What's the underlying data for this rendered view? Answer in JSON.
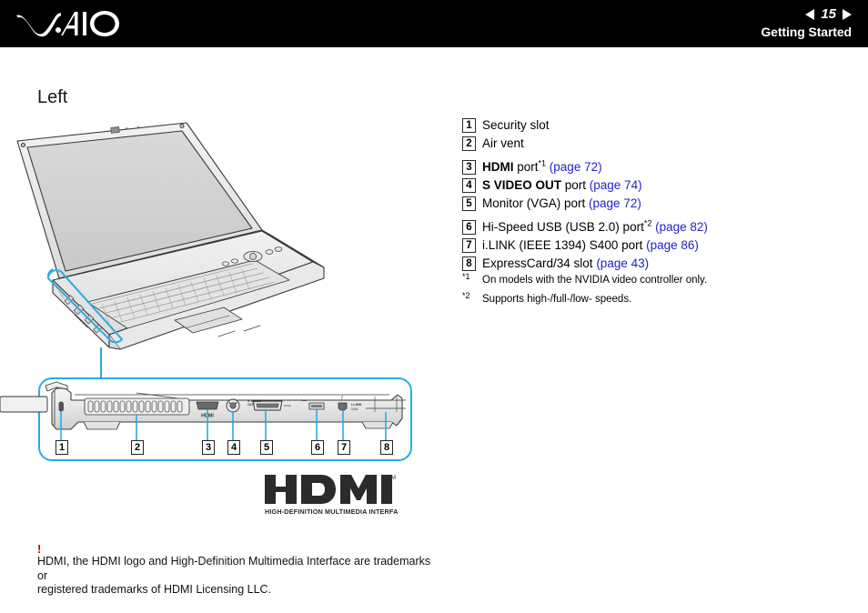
{
  "header": {
    "logo_name": "vaio-logo",
    "page_number": "15",
    "prev_icon": "triangle-left-icon",
    "next_icon": "triangle-right-icon",
    "section_title": "Getting Started",
    "background": "#000000",
    "text_color": "#ffffff"
  },
  "page": {
    "heading": "Left"
  },
  "legend": {
    "items": [
      {
        "num": "1",
        "pre": "Security slot",
        "bold": "",
        "post": "",
        "sup": "",
        "link": ""
      },
      {
        "num": "2",
        "pre": "Air vent",
        "bold": "",
        "post": "",
        "sup": "",
        "link": ""
      },
      {
        "num": "3",
        "pre": "",
        "bold": "HDMI",
        "post": " port",
        "sup": "*1",
        "link": "(page 72)"
      },
      {
        "num": "4",
        "pre": "",
        "bold": "S VIDEO OUT",
        "post": " port ",
        "sup": "",
        "link": "(page 74)"
      },
      {
        "num": "5",
        "pre": "Monitor (VGA) port ",
        "bold": "",
        "post": "",
        "sup": "",
        "link": "(page 72)"
      },
      {
        "num": "6",
        "pre": "Hi-Speed USB (USB 2.0) port",
        "bold": "",
        "post": "",
        "sup": "*2",
        "link": "(page 82)"
      },
      {
        "num": "7",
        "pre": "i.LINK (IEEE 1394) S400 port ",
        "bold": "",
        "post": "",
        "sup": "",
        "link": "(page 86)"
      },
      {
        "num": "8",
        "pre": "ExpressCard/34 slot ",
        "bold": "",
        "post": "",
        "sup": "",
        "link": "(page 43)"
      }
    ],
    "link_color": "#2222cc"
  },
  "footnotes": [
    {
      "mark": "*1",
      "text": "On models with the NVIDIA video controller only."
    },
    {
      "mark": "*2",
      "text": "Supports high-/full-/low- speeds."
    }
  ],
  "illustration": {
    "laptop_name": "laptop-open-perspective-drawing",
    "side_panel_name": "laptop-left-side-detail",
    "highlight_color": "#29ace3",
    "callout_numbers": [
      "1",
      "2",
      "3",
      "4",
      "5",
      "6",
      "7",
      "8"
    ],
    "port_labels": {
      "hdmi": "HDMI",
      "svideo_line1": "S VIDEO",
      "svideo_line2": "OUT",
      "ilink": "i.LINK",
      "ilink_sub": "S400"
    }
  },
  "hdmi_logo": {
    "wordmark": "HDMI",
    "tm": "TM",
    "tagline": "HIGH-DEFINITION MULTIMEDIA INTERFACE"
  },
  "trademark_note": {
    "bang": "!",
    "bang_color": "#cc0000",
    "line1": "HDMI, the HDMI logo and High-Definition Multimedia Interface are trademarks or",
    "line2": "registered trademarks of HDMI Licensing LLC."
  }
}
